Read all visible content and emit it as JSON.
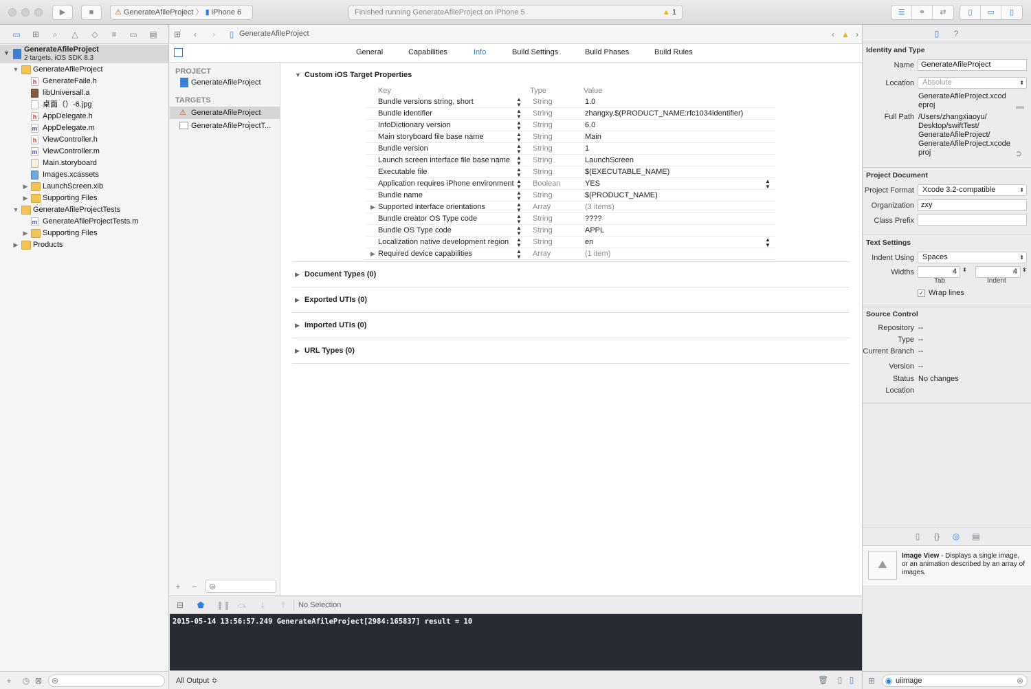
{
  "toolbar": {
    "scheme_project": "GenerateAfileProject",
    "scheme_device": "iPhone 6",
    "activity_status": "Finished running GenerateAfileProject on iPhone 5",
    "warning_count": "1"
  },
  "navigator": {
    "project_name": "GenerateAfileProject",
    "project_subtitle": "2 targets, iOS SDK 8.3",
    "items": [
      {
        "label": "GenerateAfileProject",
        "kind": "folder",
        "depth": 1,
        "disclosure": "open"
      },
      {
        "label": "GenerateFaile.h",
        "kind": "h",
        "depth": 2
      },
      {
        "label": "libUniversall.a",
        "kind": "lib",
        "depth": 2
      },
      {
        "label": "桌面（）-6.jpg",
        "kind": "image",
        "depth": 2
      },
      {
        "label": "AppDelegate.h",
        "kind": "h",
        "depth": 2
      },
      {
        "label": "AppDelegate.m",
        "kind": "m",
        "depth": 2
      },
      {
        "label": "ViewController.h",
        "kind": "h",
        "depth": 2
      },
      {
        "label": "ViewController.m",
        "kind": "m",
        "depth": 2
      },
      {
        "label": "Main.storyboard",
        "kind": "storyboard",
        "depth": 2
      },
      {
        "label": "Images.xcassets",
        "kind": "xcassets",
        "depth": 2
      },
      {
        "label": "LaunchScreen.xib",
        "kind": "folder",
        "depth": 2,
        "disclosure": "closed"
      },
      {
        "label": "Supporting Files",
        "kind": "folder",
        "depth": 2,
        "disclosure": "closed"
      },
      {
        "label": "GenerateAfileProjectTests",
        "kind": "folder",
        "depth": 1,
        "disclosure": "open"
      },
      {
        "label": "GenerateAfileProjectTests.m",
        "kind": "m",
        "depth": 2
      },
      {
        "label": "Supporting Files",
        "kind": "folder",
        "depth": 2,
        "disclosure": "closed"
      },
      {
        "label": "Products",
        "kind": "folder",
        "depth": 1,
        "disclosure": "closed"
      }
    ]
  },
  "editor": {
    "jump_title": "GenerateAfileProject",
    "tabs": [
      "General",
      "Capabilities",
      "Info",
      "Build Settings",
      "Build Phases",
      "Build Rules"
    ],
    "active_tab": "Info",
    "project_header": "PROJECT",
    "project_item": "GenerateAfileProject",
    "targets_header": "TARGETS",
    "targets": [
      "GenerateAfileProject",
      "GenerateAfileProjectT..."
    ],
    "custom_props_title": "Custom iOS Target Properties",
    "table_headers": {
      "key": "Key",
      "type": "Type",
      "value": "Value"
    },
    "properties": [
      {
        "key": "Bundle versions string, short",
        "type": "String",
        "value": "1.0"
      },
      {
        "key": "Bundle identifier",
        "type": "String",
        "value": "zhangxy.$(PRODUCT_NAME:rfc1034identifier)"
      },
      {
        "key": "InfoDictionary version",
        "type": "String",
        "value": "6.0"
      },
      {
        "key": "Main storyboard file base name",
        "type": "String",
        "value": "Main"
      },
      {
        "key": "Bundle version",
        "type": "String",
        "value": "1"
      },
      {
        "key": "Launch screen interface file base name",
        "type": "String",
        "value": "LaunchScreen"
      },
      {
        "key": "Executable file",
        "type": "String",
        "value": "$(EXECUTABLE_NAME)"
      },
      {
        "key": "Application requires iPhone environment",
        "type": "Boolean",
        "value": "YES",
        "value_stepper": true
      },
      {
        "key": "Bundle name",
        "type": "String",
        "value": "$(PRODUCT_NAME)"
      },
      {
        "key": "Supported interface orientations",
        "type": "Array",
        "value": "(3 items)",
        "expandable": true,
        "gray": true
      },
      {
        "key": "Bundle creator OS Type code",
        "type": "String",
        "value": "????"
      },
      {
        "key": "Bundle OS Type code",
        "type": "String",
        "value": "APPL"
      },
      {
        "key": "Localization native development region",
        "type": "String",
        "value": "en",
        "value_stepper": true
      },
      {
        "key": "Required device capabilities",
        "type": "Array",
        "value": "(1 item)",
        "expandable": true,
        "gray": true
      }
    ],
    "sections": [
      "Document Types (0)",
      "Exported UTIs (0)",
      "Imported UTIs (0)",
      "URL Types (0)"
    ]
  },
  "debug": {
    "selection": "No Selection",
    "console_line": "2015-05-14 13:56:57.249 GenerateAfileProject[2984:165837] result = 10",
    "output_filter": "All Output ≎"
  },
  "inspector": {
    "identity_title": "Identity and Type",
    "name_label": "Name",
    "name_value": "GenerateAfileProject",
    "location_label": "Location",
    "location_value": "Absolute",
    "location_path": [
      "GenerateAfileProject.xcod",
      "eproj"
    ],
    "full_path_label": "Full Path",
    "full_path_lines": [
      "/Users/zhangxiaoyu/",
      "Desktop/swiftTest/",
      "GenerateAfileProject/",
      "GenerateAfileProject.xcode",
      "proj"
    ],
    "project_doc_title": "Project Document",
    "project_format_label": "Project Format",
    "project_format_value": "Xcode 3.2-compatible",
    "organization_label": "Organization",
    "organization_value": "zxy",
    "class_prefix_label": "Class Prefix",
    "class_prefix_value": "",
    "text_settings_title": "Text Settings",
    "indent_using_label": "Indent Using",
    "indent_using_value": "Spaces",
    "widths_label": "Widths",
    "tab_width": "4",
    "indent_width": "4",
    "tab_caption": "Tab",
    "indent_caption": "Indent",
    "wrap_lines_label": "Wrap lines",
    "source_control_title": "Source Control",
    "repository_label": "Repository",
    "repository_value": "--",
    "type_label": "Type",
    "type_value": "--",
    "branch_label": "Current Branch",
    "branch_value": "--",
    "version_label": "Version",
    "version_value": "--",
    "status_label": "Status",
    "status_value": "No changes",
    "sc_location_label": "Location",
    "library_title": "Image View",
    "library_desc": " - Displays a single image, or an animation described by an array of images.",
    "filter_value": "uiimage"
  },
  "colors": {
    "accent": "#2f7fe0",
    "console_bg": "#272b33",
    "warning": "#e8b500"
  }
}
